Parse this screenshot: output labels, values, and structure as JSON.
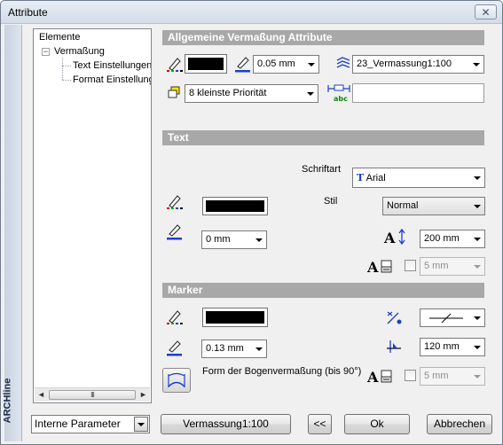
{
  "window": {
    "title": "Attribute",
    "close_glyph": "✕"
  },
  "brand": "ARCHline",
  "tree": {
    "root": "Elemente",
    "node": "Vermaßung",
    "node_toggle": "−",
    "children": [
      "Text Einstellungen",
      "Format Einstellunge"
    ],
    "scroll_grip": "III",
    "scroll_left": "◄",
    "scroll_right": "►"
  },
  "sections": {
    "general": "Allgemeine Vermaßung Attribute",
    "text": "Text",
    "marker": "Marker"
  },
  "general": {
    "line_width": "0.05 mm",
    "layer": "23_Vermassung1:100",
    "priority": "8 kleinste Priorität",
    "text_value": ""
  },
  "text": {
    "font_label": "Schriftart",
    "font": "Arial",
    "style_label": "Stil",
    "style": "Normal",
    "pen_width": "0 mm",
    "height": "200 mm",
    "offset": "5 mm"
  },
  "marker": {
    "pen_width": "0.13 mm",
    "size": "120 mm",
    "arc_label": "Form der Bogenvermaßung (bis 90°)",
    "arc_offset": "5 mm"
  },
  "footer": {
    "params": "Interne Parameter",
    "scale_button": "Vermassung1:100",
    "collapse_button": "<<",
    "ok_button": "Ok",
    "cancel_button": "Abbrechen"
  },
  "colors": {
    "section_bar": "#a8a8a8",
    "pen_color": "#000000",
    "accent_blue": "#1a3fd0"
  }
}
